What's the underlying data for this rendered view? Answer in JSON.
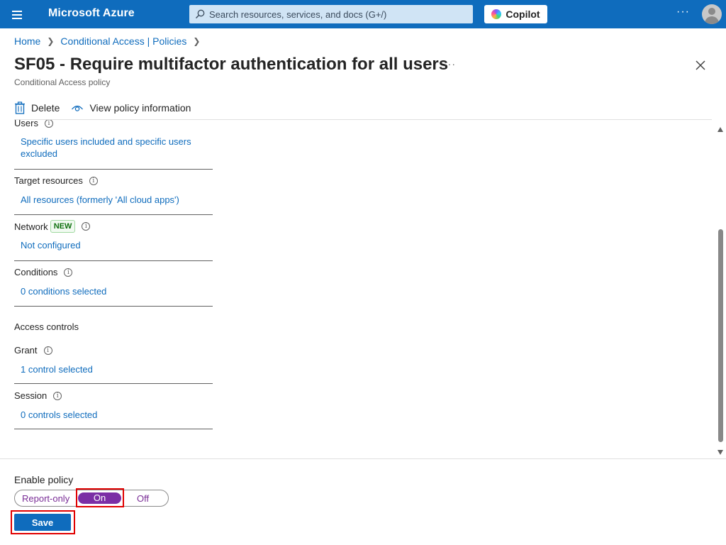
{
  "topbar": {
    "brand": "Microsoft Azure",
    "search_placeholder": "Search resources, services, and docs (G+/)",
    "copilot_label": "Copilot",
    "more_label": "···"
  },
  "breadcrumb": [
    {
      "label": "Home"
    },
    {
      "label": "Conditional Access | Policies"
    }
  ],
  "page": {
    "title": "SF05 - Require multifactor authentication for all users",
    "subtitle": "Conditional Access policy",
    "more_label": "···"
  },
  "commands": {
    "delete_label": "Delete",
    "view_info_label": "View policy information"
  },
  "sections": {
    "users": {
      "label": "Users",
      "value_line1": "Specific users included and specific users",
      "value_line2": "excluded"
    },
    "target_resources": {
      "label": "Target resources",
      "value": "All resources (formerly 'All cloud apps')"
    },
    "network": {
      "label": "Network",
      "badge": "NEW",
      "value": "Not configured"
    },
    "conditions": {
      "label": "Conditions",
      "value": "0 conditions selected"
    },
    "access_controls_title": "Access controls",
    "grant": {
      "label": "Grant",
      "value": "1 control selected"
    },
    "session": {
      "label": "Session",
      "value": "0 controls selected"
    }
  },
  "footer": {
    "enable_label": "Enable policy",
    "options": [
      "Report-only",
      "On",
      "Off"
    ],
    "selected": "On",
    "save_label": "Save"
  },
  "colors": {
    "topbar": "#0f6cbd",
    "link": "#0f6cbd",
    "toggle_selected": "#7b2ea5",
    "highlight": "#e00000"
  }
}
